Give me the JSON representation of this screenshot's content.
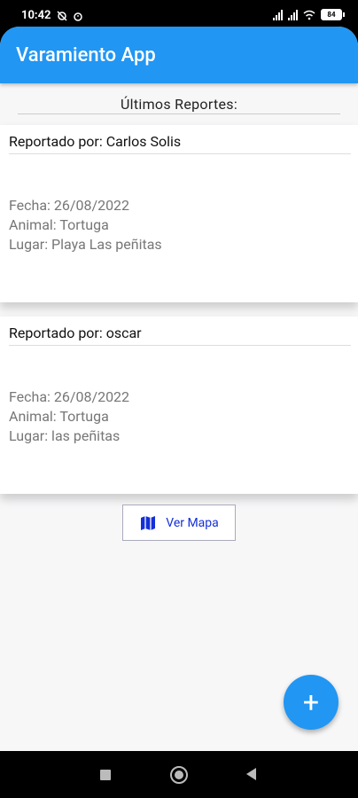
{
  "status_bar": {
    "time": "10:42",
    "battery": "84"
  },
  "app_bar": {
    "title": "Varamiento App"
  },
  "subtitle": "Últimos Reportes:",
  "reports": [
    {
      "reporter": "Reportado por: Carlos Solis",
      "fecha": "Fecha: 26/08/2022",
      "animal": "Animal: Tortuga",
      "lugar": "Lugar: Playa Las peñitas"
    },
    {
      "reporter": "Reportado por: oscar",
      "fecha": "Fecha: 26/08/2022",
      "animal": "Animal: Tortuga",
      "lugar": "Lugar: las peñitas"
    }
  ],
  "map_button": {
    "label": "Ver Mapa",
    "icon": "map-icon"
  },
  "fab": {
    "label": "+",
    "icon": "add-icon"
  },
  "colors": {
    "primary": "#2196f3",
    "button_text": "#1530d8",
    "background": "#f7f7f8"
  }
}
